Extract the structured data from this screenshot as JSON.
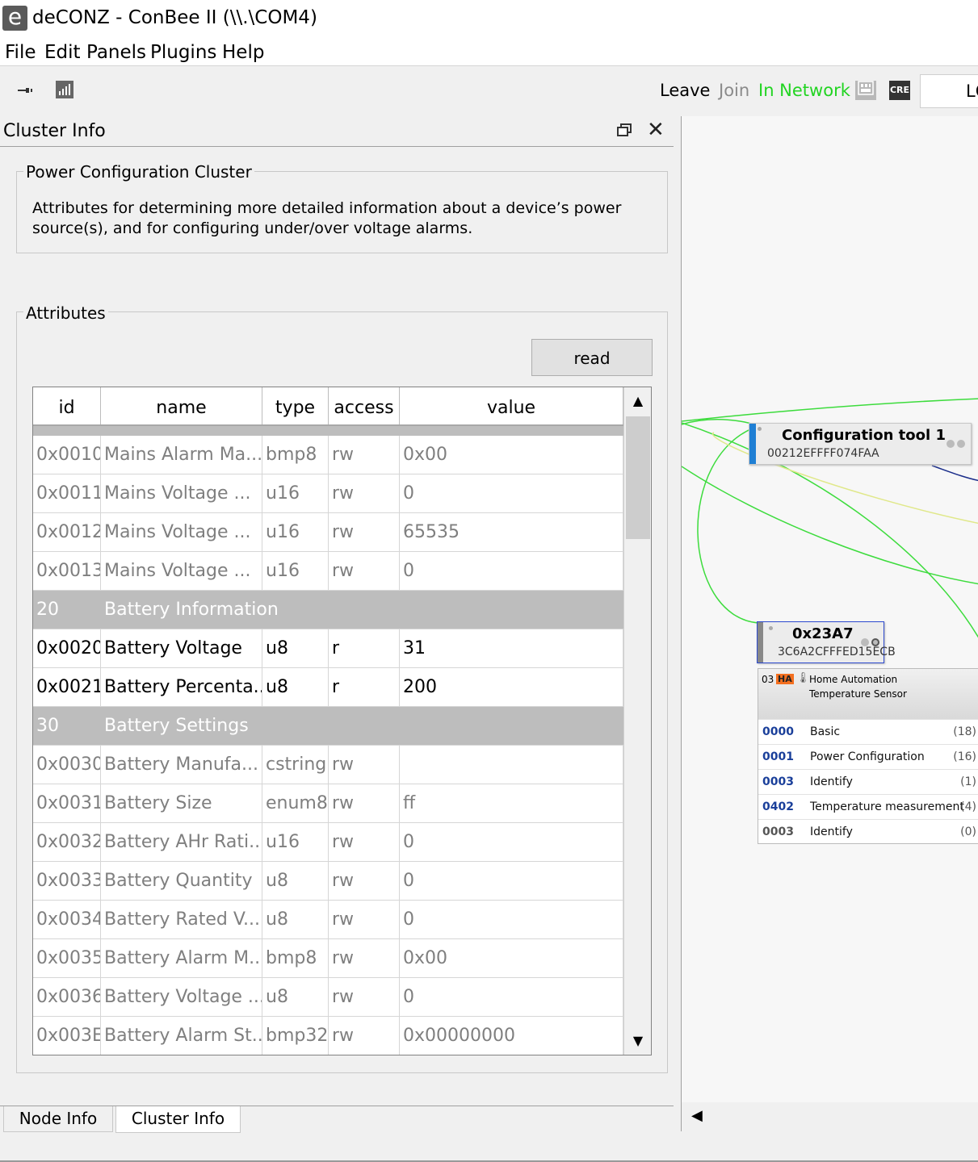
{
  "window": {
    "title": "deCONZ - ConBee II (\\\\.\\COM4)",
    "logo_letter": "e"
  },
  "menu": [
    "File",
    "Edit",
    "Panels",
    "Plugins",
    "Help"
  ],
  "toolbar": {
    "leave": "Leave",
    "join": "Join",
    "status": "In Network",
    "badge": "CRE",
    "combo_text": "LC",
    "status_color": "#21d421"
  },
  "panel": {
    "title": "Cluster Info",
    "cluster_group_label": "Power Configuration Cluster",
    "description": "Attributes for determining more detailed information about a device’s power source(s), and for configuring under/over voltage alarms.",
    "attributes_label": "Attributes",
    "read_button": "read"
  },
  "table": {
    "headers": [
      "id",
      "name",
      "type",
      "access",
      "value"
    ],
    "rows": [
      {
        "id": "0x0010",
        "name": "Mains Alarm Ma...",
        "type": "bmp8",
        "access": "rw",
        "value": "0x00",
        "kind": "muted"
      },
      {
        "id": "0x0011",
        "name": "Mains Voltage ...",
        "type": "u16",
        "access": "rw",
        "value": "0",
        "kind": "muted"
      },
      {
        "id": "0x0012",
        "name": "Mains Voltage ...",
        "type": "u16",
        "access": "rw",
        "value": "65535",
        "kind": "muted"
      },
      {
        "id": "0x0013",
        "name": "Mains Voltage ...",
        "type": "u16",
        "access": "rw",
        "value": "0",
        "kind": "muted"
      },
      {
        "id": "20",
        "name": "Battery Information",
        "type": "",
        "access": "",
        "value": "",
        "kind": "group"
      },
      {
        "id": "0x0020",
        "name": "Battery Voltage",
        "type": "u8",
        "access": "r",
        "value": "31",
        "kind": "normal"
      },
      {
        "id": "0x0021",
        "name": "Battery Percenta...",
        "type": "u8",
        "access": "r",
        "value": "200",
        "kind": "normal"
      },
      {
        "id": "30",
        "name": "Battery Settings",
        "type": "",
        "access": "",
        "value": "",
        "kind": "group"
      },
      {
        "id": "0x0030",
        "name": "Battery Manufa...",
        "type": "cstring",
        "access": "rw",
        "value": "",
        "kind": "muted"
      },
      {
        "id": "0x0031",
        "name": "Battery Size",
        "type": "enum8",
        "access": "rw",
        "value": "ff",
        "kind": "muted"
      },
      {
        "id": "0x0032",
        "name": "Battery AHr Rati...",
        "type": "u16",
        "access": "rw",
        "value": "0",
        "kind": "muted"
      },
      {
        "id": "0x0033",
        "name": "Battery Quantity",
        "type": "u8",
        "access": "rw",
        "value": "0",
        "kind": "muted"
      },
      {
        "id": "0x0034",
        "name": "Battery Rated V...",
        "type": "u8",
        "access": "rw",
        "value": "0",
        "kind": "muted"
      },
      {
        "id": "0x0035",
        "name": "Battery Alarm M...",
        "type": "bmp8",
        "access": "rw",
        "value": "0x00",
        "kind": "muted"
      },
      {
        "id": "0x0036",
        "name": "Battery Voltage ...",
        "type": "u8",
        "access": "rw",
        "value": "0",
        "kind": "muted"
      },
      {
        "id": "0x003E",
        "name": "Battery Alarm St...",
        "type": "bmp32",
        "access": "rw",
        "value": "0x00000000",
        "kind": "muted"
      }
    ]
  },
  "tabs": [
    "Node Info",
    "Cluster Info"
  ],
  "graph": {
    "node1": {
      "title": "Configuration tool 1",
      "mac": "00212EFFFF074FAA"
    },
    "node2": {
      "title": "0x23A7",
      "mac": "3C6A2CFFFED15ECB"
    },
    "endpoint": {
      "ep": "03",
      "profile_badge": "HA",
      "profile": "Home Automation",
      "device": "Temperature Sensor",
      "clusters": [
        {
          "id": "0000",
          "name": "Basic",
          "count": "(18)",
          "kind": "in"
        },
        {
          "id": "0001",
          "name": "Power Configuration",
          "count": "(16)",
          "kind": "in"
        },
        {
          "id": "0003",
          "name": "Identify",
          "count": "(1)",
          "kind": "in"
        },
        {
          "id": "0402",
          "name": "Temperature measurement",
          "count": "(4)",
          "kind": "in"
        },
        {
          "id": "0003",
          "name": "Identify",
          "count": "(0)",
          "kind": "out"
        }
      ]
    }
  }
}
